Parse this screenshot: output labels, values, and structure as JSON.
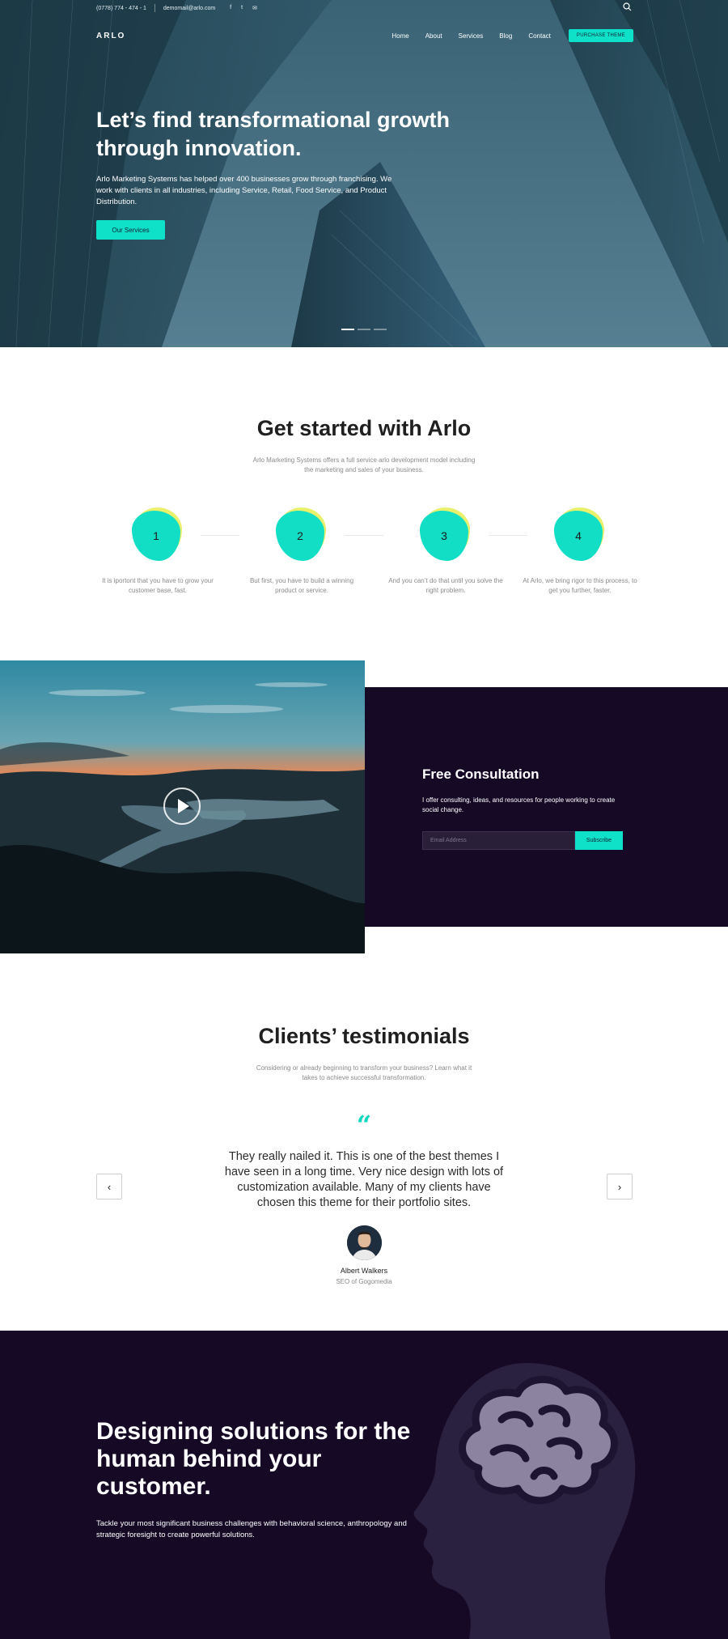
{
  "topbar": {
    "phone": "(0778) 774 - 474 - 1",
    "email": "demomail@arlo.com",
    "social": [
      "facebook-icon",
      "twitter-icon",
      "email-icon"
    ]
  },
  "nav": {
    "logo": "ARLO",
    "items": [
      "Home",
      "About",
      "Services",
      "Blog",
      "Contact"
    ],
    "cta": "PURCHASE THEME"
  },
  "hero": {
    "title": "Let’s find transformational growth through innovation.",
    "text": "Arlo Marketing Systems has helped over 400 businesses grow through franchising. We work with clients in all industries, including Service, Retail, Food Service, and Product Distribution.",
    "button": "Our Services",
    "slides": 3,
    "active_slide": 1
  },
  "get_started": {
    "title": "Get started with Arlo",
    "subtitle": "Arlo Marketing Systems offers a full service arlo development model including the marketing and sales of your business.",
    "steps": [
      {
        "number": "1",
        "text": "It is iportont that you have to grow your customer base, fast."
      },
      {
        "number": "2",
        "text": "But first, you have to build a winning product or service."
      },
      {
        "number": "3",
        "text": "And you can’t do that until you solve the right problem."
      },
      {
        "number": "4",
        "text": "At Arlo, we bring rigor to this process, to get you further, faster."
      }
    ]
  },
  "consultation": {
    "title": "Free Consultation",
    "text": "I offer consulting, ideas, and resources for people working to create social change.",
    "email_placeholder": "Email Address",
    "button": "Subscribe"
  },
  "testimonials": {
    "title": "Clients’ testimonials",
    "subtitle": "Considering or already beginning to transform your business? Learn what it takes to achieve successful transformation.",
    "quote_mark": "“",
    "quote": "They really nailed it. This is one of the best themes I have seen in a long time. Very nice design with lots of customization available. Many of my clients have chosen this theme for their portfolio sites.",
    "name": "Albert Walkers",
    "role": "SEO of Gogomedia",
    "prev": "‹",
    "next": "›"
  },
  "designing": {
    "title": "Designing solutions for the human behind your customer.",
    "text": "Tackle your most significant business challenges with behavioral science, anthropology and strategic foresight to create powerful solutions."
  },
  "colors": {
    "accent": "#0fe0c8",
    "dark": "#150926"
  }
}
